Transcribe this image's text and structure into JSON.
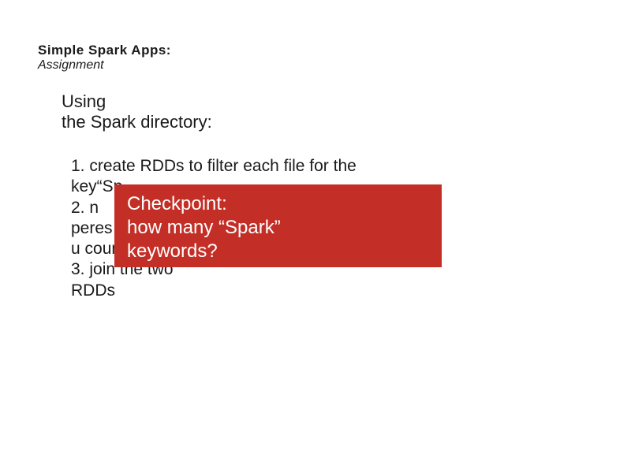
{
  "header": {
    "title": "Simple Spark Apps:",
    "subtitle": "Assignment"
  },
  "intro": {
    "line1": "Using",
    "line2": "the Spark directory:"
  },
  "body": {
    "l1": "1.  create RDDs to filter each file for the",
    "l2": "key“Sp",
    "l3": "2.     n",
    "l4": "peres",
    "l5": "   u    count)",
    "l6": "3. join the two",
    "l7": "RDDs"
  },
  "overlay": {
    "line1": "Checkpoint:",
    "line2": "how many “Spark”",
    "line3": "keywords?"
  }
}
